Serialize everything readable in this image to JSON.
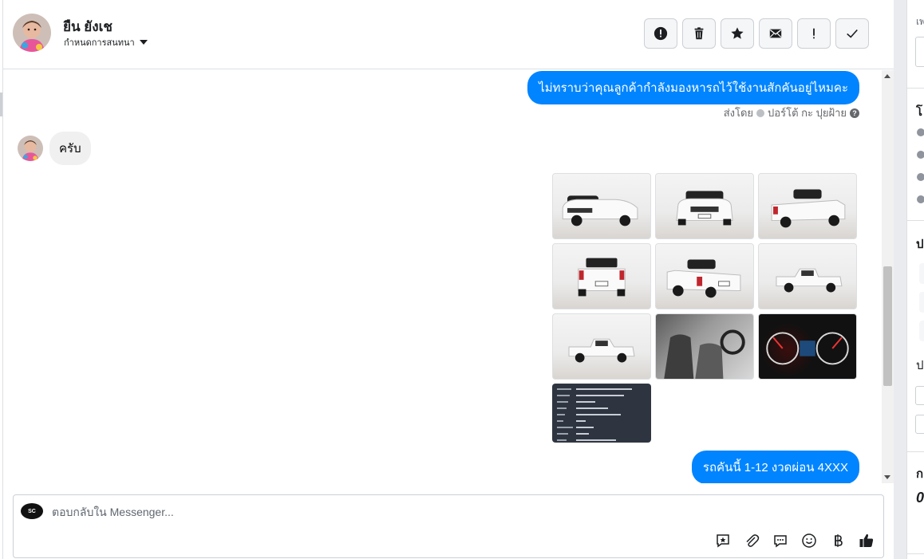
{
  "header": {
    "contact_name": "ยืน ยังเช",
    "assign_label": "กำหนดการสนทนา"
  },
  "messages": {
    "outgoing_1": "ไม่ทราบว่าคุณลูกค้ากำลังมองหารถไว้ใช้งานสักคันอยู่ไหมคะ",
    "sent_by_label": "ส่งโดย",
    "sent_by_name": "ปอร์โต้ กะ ปุยฝ้าย",
    "help_symbol": "?",
    "incoming_1": "ครับ",
    "outgoing_2": "รถคันนี้ 1-12 งวดผ่อน 4XXX"
  },
  "composer": {
    "placeholder": "ตอบกลับใน Messenger...",
    "page_logo_text": "SC"
  },
  "right_panel": {
    "search_hint": "เพ",
    "section_1_initial": "โ",
    "section_2_initial": "ป",
    "section_3_initial": "ป",
    "section_4_initial": "ก",
    "value_glyph": "0"
  },
  "icons": {
    "header_actions": [
      "alert-circle-icon",
      "trash-icon",
      "star-icon",
      "envelope-icon",
      "exclamation-icon",
      "checkmark-icon"
    ],
    "composer_tools": [
      "saved-reply-icon",
      "paperclip-icon",
      "chat-bubble-icon",
      "emoji-icon",
      "baht-icon",
      "thumbs-up-icon"
    ]
  },
  "colors": {
    "outgoing_bubble": "#0084ff",
    "incoming_bubble": "#f0f0f0",
    "border": "#dddfe2"
  }
}
